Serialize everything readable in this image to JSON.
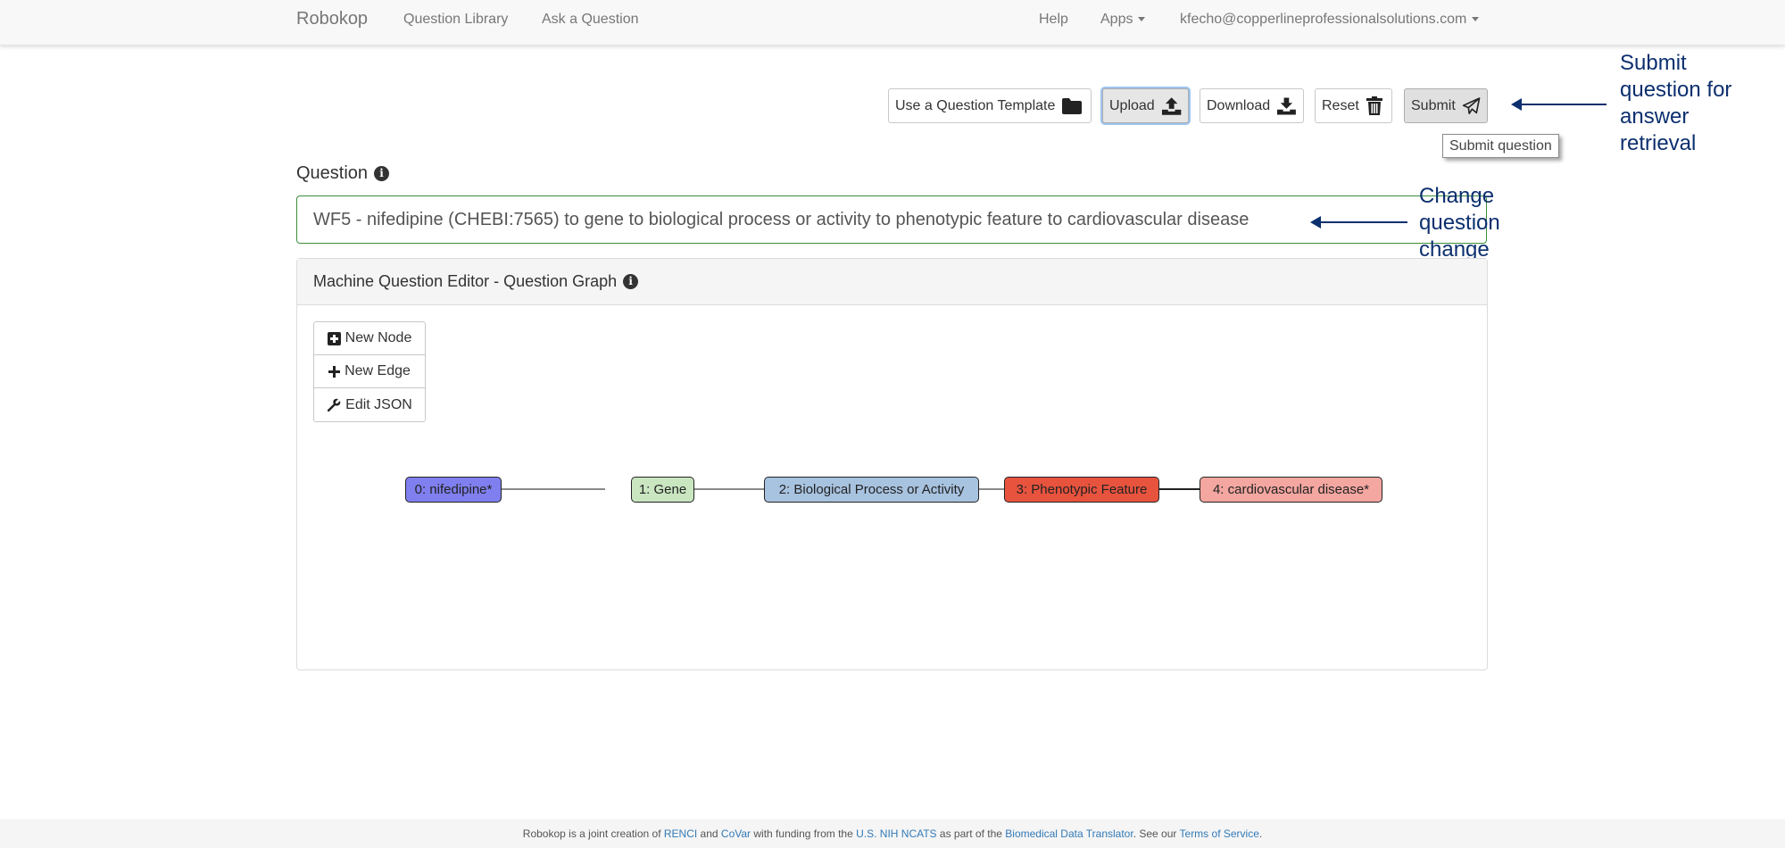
{
  "navbar": {
    "brand": "Robokop",
    "links": [
      "Question Library",
      "Ask a Question"
    ],
    "help": "Help",
    "apps": "Apps",
    "user": "kfecho@copperlineprofessionalsolutions.com"
  },
  "toolbar": {
    "template_label": "Use a Question Template",
    "upload_label": "Upload",
    "download_label": "Download",
    "reset_label": "Reset",
    "submit_label": "Submit",
    "submit_tooltip": "Submit question"
  },
  "annotations": {
    "submit_note": [
      "Submit",
      "question for",
      "answer",
      "retrieval"
    ],
    "change_note": [
      "Change",
      "question",
      "change"
    ]
  },
  "question": {
    "label": "Question",
    "value": "WF5 - nifedipine (CHEBI:7565) to gene to biological process or activity to phenotypic feature to cardiovascular disease"
  },
  "editor": {
    "title": "Machine Question Editor - Question Graph",
    "new_node": "New Node",
    "new_edge": "New Edge",
    "edit_json": "Edit JSON",
    "nodes": [
      {
        "label": "0: nifedipine*",
        "color": "#7f7fef"
      },
      {
        "label": "1: Gene",
        "color": "#c9e6c1"
      },
      {
        "label": "2: Biological Process or Activity",
        "color": "#a8c3e0"
      },
      {
        "label": "3: Phenotypic Feature",
        "color": "#e8533e"
      },
      {
        "label": "4: cardiovascular disease*",
        "color": "#f4a6a0"
      }
    ]
  },
  "footer": {
    "t1": "Robokop is a joint creation of ",
    "renci": "RENCI",
    "t2": " and ",
    "covar": "CoVar",
    "t3": " with funding from the ",
    "ncats": "U.S. NIH NCATS",
    "t4": " as part of the ",
    "bdt": "Biomedical Data Translator",
    "t5": ". See our ",
    "tos": "Terms of Service",
    "t6": "."
  }
}
